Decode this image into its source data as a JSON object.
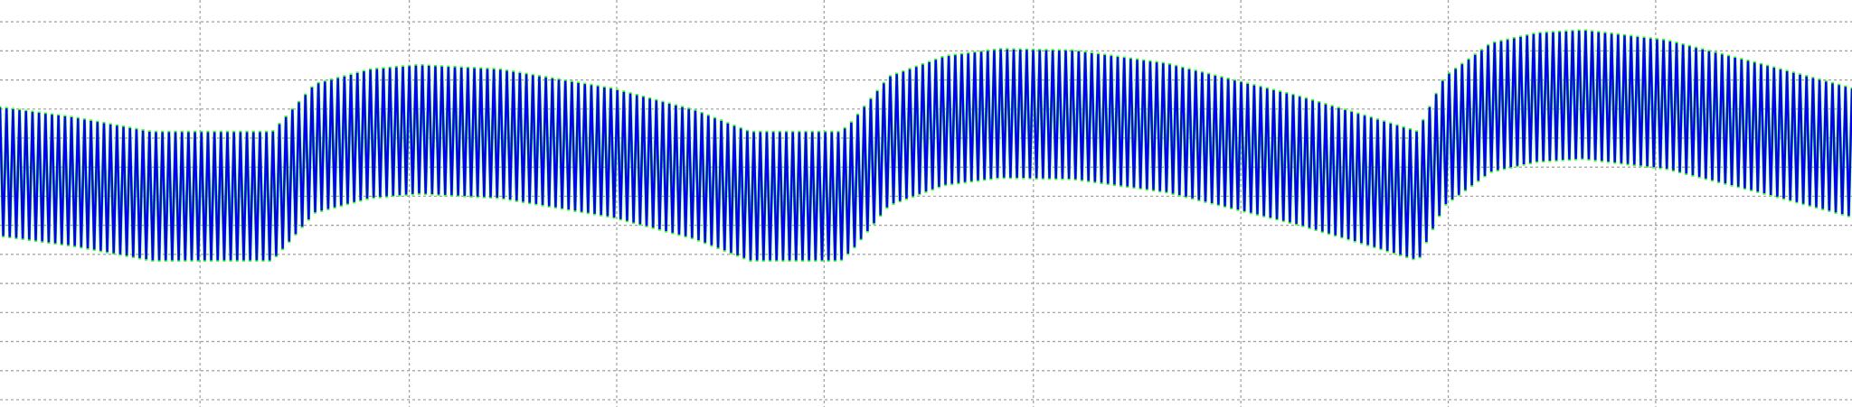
{
  "chart_data": {
    "type": "line",
    "title": "",
    "xlabel": "",
    "ylabel": "",
    "grid": true,
    "legend": "none",
    "xlim": [
      0,
      100
    ],
    "ylim": [
      -1.5,
      1.3
    ],
    "x_gridlines": [
      10.8,
      22.1,
      33.3,
      44.5,
      55.8,
      67.0,
      78.2,
      89.4
    ],
    "y_gridlines": [
      -1.45,
      -1.25,
      -1.05,
      -0.85,
      -0.65,
      -0.45,
      -0.25,
      -0.05,
      0.15,
      0.35,
      0.55,
      0.75,
      0.95,
      1.15
    ],
    "oscillation": {
      "cycles": 285,
      "carrier": "triangle"
    },
    "series": [
      {
        "color": "#33ff33",
        "role": "envelope",
        "center": [
          [
            0,
            0.12
          ],
          [
            4,
            0.05
          ],
          [
            8.2,
            -0.05
          ],
          [
            14.7,
            -0.05
          ],
          [
            15.2,
            0.02
          ],
          [
            17,
            0.28
          ],
          [
            20,
            0.38
          ],
          [
            22.6,
            0.41
          ],
          [
            27,
            0.38
          ],
          [
            33,
            0.25
          ],
          [
            37.5,
            0.1
          ],
          [
            40.5,
            -0.05
          ],
          [
            45.4,
            -0.05
          ],
          [
            46,
            0.02
          ],
          [
            48,
            0.33
          ],
          [
            51,
            0.47
          ],
          [
            54,
            0.52
          ],
          [
            58,
            0.51
          ],
          [
            63,
            0.42
          ],
          [
            70,
            0.2
          ],
          [
            73.5,
            0.07
          ],
          [
            76.6,
            -0.05
          ],
          [
            76.8,
            0.02
          ],
          [
            78,
            0.33
          ],
          [
            80.5,
            0.56
          ],
          [
            83,
            0.63
          ],
          [
            85.5,
            0.65
          ],
          [
            90,
            0.58
          ],
          [
            95,
            0.42
          ],
          [
            100,
            0.25
          ]
        ],
        "amplitude": [
          [
            0,
            0.45
          ],
          [
            8.2,
            0.45
          ],
          [
            14.7,
            0.45
          ],
          [
            15.2,
            0.45
          ],
          [
            100,
            0.45
          ]
        ]
      },
      {
        "color": "#0000ee",
        "role": "signal",
        "center": [
          [
            0,
            0.12
          ],
          [
            4,
            0.05
          ],
          [
            8.2,
            -0.05
          ],
          [
            14.7,
            -0.05
          ],
          [
            15.2,
            0.02
          ],
          [
            17,
            0.28
          ],
          [
            20,
            0.38
          ],
          [
            22.6,
            0.41
          ],
          [
            27,
            0.38
          ],
          [
            33,
            0.25
          ],
          [
            37.5,
            0.1
          ],
          [
            40.5,
            -0.05
          ],
          [
            45.4,
            -0.05
          ],
          [
            46,
            0.02
          ],
          [
            48,
            0.33
          ],
          [
            51,
            0.47
          ],
          [
            54,
            0.52
          ],
          [
            58,
            0.51
          ],
          [
            63,
            0.42
          ],
          [
            70,
            0.2
          ],
          [
            73.5,
            0.07
          ],
          [
            76.6,
            -0.05
          ],
          [
            76.8,
            0.02
          ],
          [
            78,
            0.33
          ],
          [
            80.5,
            0.56
          ],
          [
            83,
            0.63
          ],
          [
            85.5,
            0.65
          ],
          [
            90,
            0.58
          ],
          [
            95,
            0.42
          ],
          [
            100,
            0.25
          ]
        ],
        "amplitude": [
          [
            0,
            0.44
          ],
          [
            100,
            0.44
          ]
        ]
      }
    ]
  }
}
